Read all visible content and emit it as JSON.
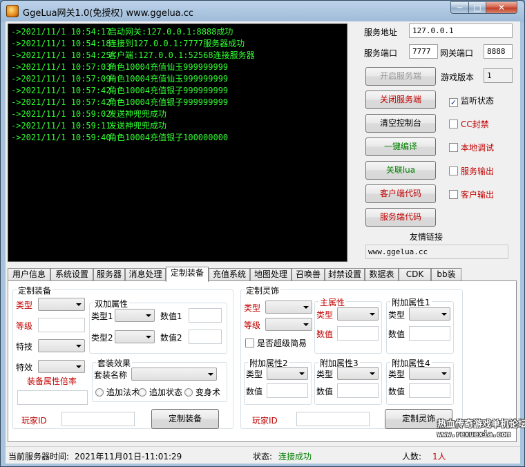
{
  "window": {
    "title": "GgeLua网关1.0(免授权) www.ggelua.cc",
    "min": "─",
    "max": "□",
    "close": "✕"
  },
  "console": {
    "lines": [
      {
        "time": "->2021/11/1 10:54:17",
        "msg": "启动网关:127.0.0.1:8888成功"
      },
      {
        "time": "->2021/11/1 10:54:18",
        "msg": "连接到127.0.0.1:7777服务器成功"
      },
      {
        "time": "->2021/11/1 10:54:25",
        "msg": "客户端:127.0.0.1:52568连接服务器"
      },
      {
        "time": "->2021/11/1 10:57:03",
        "msg": "角色10004充值仙玉999999999"
      },
      {
        "time": "->2021/11/1 10:57:09",
        "msg": "角色10004充值仙玉999999999"
      },
      {
        "time": "->2021/11/1 10:57:42",
        "msg": "角色10004充值银子999999999"
      },
      {
        "time": "->2021/11/1 10:57:42",
        "msg": "角色10004充值银子999999999"
      },
      {
        "time": "->2021/11/1 10:59:02",
        "msg": "发送神兜兜成功"
      },
      {
        "time": "->2021/11/1 10:59:11",
        "msg": "发送神兜兜成功"
      },
      {
        "time": "->2021/11/1 10:59:40",
        "msg": "角色10004充值银子100000000"
      }
    ]
  },
  "server": {
    "address_label": "服务地址",
    "address_value": "127.0.0.1",
    "port_label": "服务端口",
    "port_value": "7777",
    "gateway_port_label": "网关端口",
    "gateway_port_value": "8888",
    "version_label": "游戏版本",
    "version_value": "1"
  },
  "buttons": {
    "start": "开启服务端",
    "stop": "关闭服务端",
    "clear": "清空控制台",
    "compile": "一键编译",
    "lua": "关联lua",
    "client_code": "客户端代码",
    "server_code": "服务端代码"
  },
  "checks": {
    "listen": "监听状态",
    "listen_checked": "✓",
    "cc": "CC封禁",
    "local_debug": "本地调试",
    "server_out": "服务输出",
    "client_out": "客户输出"
  },
  "links": {
    "label": "友情链接",
    "value": "www.ggelua.cc"
  },
  "tabs": [
    "用户信息",
    "系统设置",
    "服务器",
    "消息处理",
    "定制装备",
    "充值系统",
    "地图处理",
    "召唤兽",
    "封禁设置",
    "数据表",
    "CDK",
    "bb装"
  ],
  "equip": {
    "group_title": "定制装备",
    "type": "类型",
    "level": "等级",
    "skill": "特技",
    "effect": "特效",
    "attr_rate": "装备属性倍率",
    "double_title": "双加属性",
    "type1": "类型1",
    "value1": "数值1",
    "type2": "类型2",
    "value2": "数值2",
    "set_title": "套装效果",
    "set_name": "套装名称",
    "radio1": "追加法术",
    "radio2": "追加状态",
    "radio3": "变身术",
    "player_id": "玩家ID",
    "submit": "定制装备"
  },
  "spirit": {
    "group_title": "定制灵饰",
    "type": "类型",
    "level": "等级",
    "super": "是否超级简易",
    "main_title": "主属性",
    "main_type": "类型",
    "main_value": "数值",
    "add1_title": "附加属性1",
    "add2_title": "附加属性2",
    "add3_title": "附加属性3",
    "add4_title": "附加属性4",
    "sub_type": "类型",
    "sub_value": "数值",
    "player_id": "玩家ID",
    "submit": "定制灵饰"
  },
  "status": {
    "time_label": "当前服务器时间:",
    "time_value": "2021年11月01日-11:01:29",
    "state_label": "状态:",
    "state_value": "连接成功",
    "people_label": "人数:",
    "people_value": "1人"
  },
  "watermark": {
    "line1": "热血传奇游戏单机论坛",
    "line2": "www.rexuexia.com"
  }
}
